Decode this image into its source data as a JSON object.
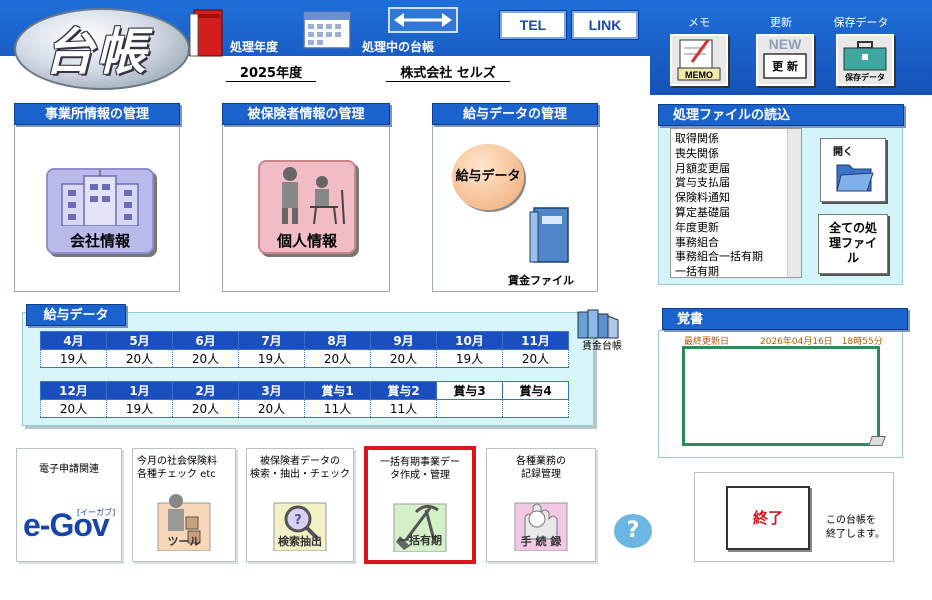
{
  "header": {
    "logo_text": "台帳",
    "fiscal_year_label": "処理年度",
    "fiscal_year_value": "2025年度",
    "current_ledger_label": "処理中の台帳",
    "current_ledger_value": "株式会社 セルズ",
    "tel_label": "TEL",
    "link_label": "LINK",
    "memo_label": "メモ",
    "memo_icon_text": "MEMO",
    "update_label": "更新",
    "update_icon_text": "更 新",
    "update_badge": "NEW",
    "save_label": "保存データ",
    "save_icon_text": "保存データ"
  },
  "sections": {
    "office": {
      "title": "事業所情報の管理",
      "button_label": "会社情報"
    },
    "insured": {
      "title": "被保険者情報の管理",
      "button_label": "個人情報"
    },
    "salary_mgmt": {
      "title": "給与データの管理",
      "button_label": "給与データ",
      "wage_file_label": "賃金ファイル"
    }
  },
  "salary": {
    "title": "給与データ",
    "ledger_label": "賃金台帳",
    "row1_months": [
      "4月",
      "5月",
      "6月",
      "7月",
      "8月",
      "9月",
      "10月",
      "11月"
    ],
    "row1_counts": [
      "19人",
      "20人",
      "20人",
      "19人",
      "20人",
      "20人",
      "19人",
      "20人"
    ],
    "row2_months": [
      "12月",
      "1月",
      "2月",
      "3月",
      "賞与1",
      "賞与2",
      "賞与3",
      "賞与4"
    ],
    "row2_counts": [
      "20人",
      "19人",
      "20人",
      "20人",
      "11人",
      "11人",
      "",
      ""
    ]
  },
  "files": {
    "title": "処理ファイルの読込",
    "items": [
      "取得関係",
      "喪失関係",
      "月額変更届",
      "賞与支払届",
      "保険料通知",
      "算定基礎届",
      "年度更新",
      "事務組合",
      "事務組合一括有期",
      "一括有期"
    ],
    "open_label": "開く",
    "all_files_label": "全ての処 理ファイル"
  },
  "memo": {
    "title": "覚書",
    "last_updated_label": "最終更新日",
    "last_updated_value": "2026年04月16日　18時55分"
  },
  "tools": [
    {
      "title": "電子申請関連",
      "label": "e-Gov",
      "sub": "[イーガブ]"
    },
    {
      "title": "今月の社会保険料\n各種チェック etc",
      "label": "ツール"
    },
    {
      "title": "被保険者データの\n検索・抽出・チェック",
      "label": "検索抽出"
    },
    {
      "title": "一括有期事業デー\nタ作成・管理",
      "label": "一括有期"
    },
    {
      "title": "各種業務の\n記録管理",
      "label": "手 続 録"
    }
  ],
  "help_symbol": "?",
  "end": {
    "button_label": "終了",
    "description": "この台帳を\n終了します。"
  },
  "colors": {
    "header_blue": "#1f6fd8",
    "tab_blue": "#1b63cc",
    "highlight_red": "#e0141c",
    "memo_green": "#2e8b57"
  }
}
